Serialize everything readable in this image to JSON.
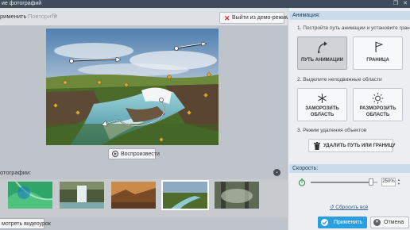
{
  "window": {
    "title": "ие фотографий"
  },
  "toolbar": {
    "apply_label": "рименить",
    "repeat_label": "Повторить",
    "demo_exit_label": "Выйти из демо-режима"
  },
  "preview": {
    "play_label": "Воспроизвести"
  },
  "photos": {
    "label": "отографии:",
    "selected_index": 3,
    "thumbnails": [
      "green-abstract",
      "waterfall",
      "canyon-sunset",
      "river-landscape",
      "foggy-forest"
    ]
  },
  "bottom": {
    "video_button_label": "мотреть видеоурок"
  },
  "animation": {
    "header": "Анимация:",
    "step1": "1. Постройте путь анимации и установите границы",
    "path_button": "ПУТЬ АНИМАЦИИ",
    "border_button": "ГРАНИЦА",
    "step2": "2. Выделите неподвижные области",
    "freeze_button_line1": "ЗАМОРОЗИТЬ",
    "freeze_button_line2": "ОБЛАСТЬ",
    "unfreeze_button_line1": "РАЗМОРОЗИТЬ",
    "unfreeze_button_line2": "ОБЛАСТЬ",
    "step3": "3. Режим удаления объектов",
    "delete_button": "УДАЛИТЬ ПУТЬ ИЛИ ГРАНИЦУ"
  },
  "speed": {
    "header": "Скорость:",
    "value": "250%",
    "level_fraction": 0.9,
    "reset_label": "Сбросить всё"
  },
  "footer": {
    "apply_label": "Применить",
    "cancel_label": "Отмена"
  },
  "colors": {
    "accent": "#2a9fe0",
    "section_header": "#c9dceb",
    "titlebar": "#3f4c5c",
    "demo_exit_x": "#d0312d"
  }
}
